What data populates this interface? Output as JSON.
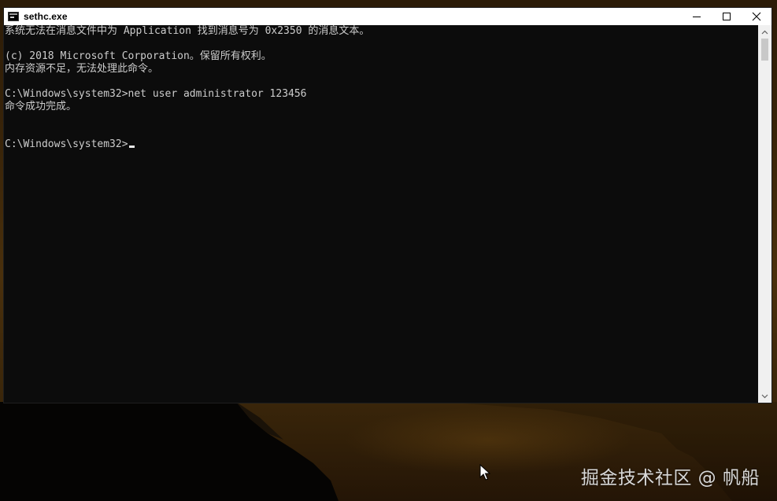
{
  "window": {
    "title": "sethc.exe",
    "icon": "console-icon",
    "controls": [
      "minimize-icon",
      "maximize-icon",
      "close-icon"
    ]
  },
  "console": {
    "lines": [
      "系统无法在消息文件中为 Application 找到消息号为 0x2350 的消息文本。",
      "",
      "(c) 2018 Microsoft Corporation。保留所有权利。",
      "内存资源不足，无法处理此命令。",
      "",
      "C:\\Windows\\system32>net user administrator 123456",
      "命令成功完成。",
      "",
      "",
      "C:\\Windows\\system32>"
    ],
    "text_color": "#cccccc",
    "background_color": "#0c0c0c"
  },
  "scrollbar": {
    "up_icon": "chevron-up-icon",
    "down_icon": "chevron-down-icon"
  },
  "watermark": {
    "text": "掘金技术社区 @ 帆船"
  },
  "desktop": {
    "cursor_icon": "mouse-pointer-icon"
  }
}
